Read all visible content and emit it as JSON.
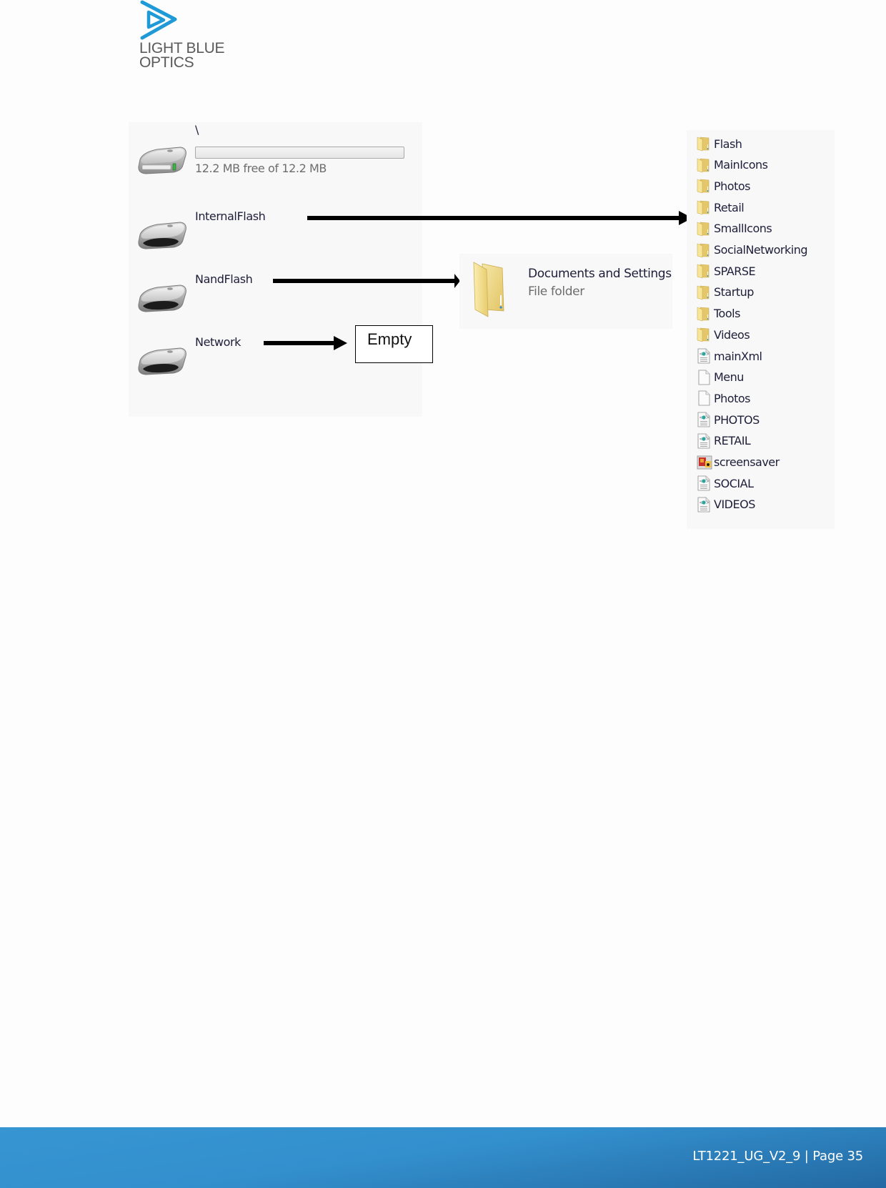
{
  "header": {
    "logo_line1": "LIGHT BLUE",
    "logo_line2": "OPTICS",
    "brand_color": "#1f9ad6"
  },
  "drives_panel": {
    "drives": [
      {
        "name": "\\",
        "icon": "hard-drive-icon",
        "usage_used_fraction": 0.0,
        "free_text": "12.2 MB free of 12.2 MB"
      },
      {
        "name": "InternalFlash",
        "icon": "removable-drive-icon"
      },
      {
        "name": "NandFlash",
        "icon": "removable-drive-icon"
      },
      {
        "name": "Network",
        "icon": "removable-drive-icon"
      }
    ]
  },
  "annotations": {
    "network_result": "Empty"
  },
  "nandflash_contents": {
    "name": "Documents and Settings",
    "type": "File folder",
    "icon": "folder-icon"
  },
  "internalflash_contents": {
    "items": [
      {
        "name": "Flash",
        "icon": "folder"
      },
      {
        "name": "MainIcons",
        "icon": "folder"
      },
      {
        "name": "Photos",
        "icon": "folder"
      },
      {
        "name": "Retail",
        "icon": "folder"
      },
      {
        "name": "SmallIcons",
        "icon": "folder"
      },
      {
        "name": "SocialNetworking",
        "icon": "folder"
      },
      {
        "name": "SPARSE",
        "icon": "folder"
      },
      {
        "name": "Startup",
        "icon": "folder"
      },
      {
        "name": "Tools",
        "icon": "folder"
      },
      {
        "name": "Videos",
        "icon": "folder"
      },
      {
        "name": "mainXml",
        "icon": "xml-file"
      },
      {
        "name": "Menu",
        "icon": "blank-file"
      },
      {
        "name": "Photos",
        "icon": "blank-file"
      },
      {
        "name": "PHOTOS",
        "icon": "xml-file"
      },
      {
        "name": "RETAIL",
        "icon": "xml-file"
      },
      {
        "name": "screensaver",
        "icon": "image-file"
      },
      {
        "name": "SOCIAL",
        "icon": "xml-file"
      },
      {
        "name": "VIDEOS",
        "icon": "xml-file"
      }
    ]
  },
  "footer": {
    "doc_id": "LT1221_UG_V2_9",
    "separator": "|",
    "page_label": "Page 35",
    "text": "LT1221_UG_V2_9 | Page 35"
  }
}
